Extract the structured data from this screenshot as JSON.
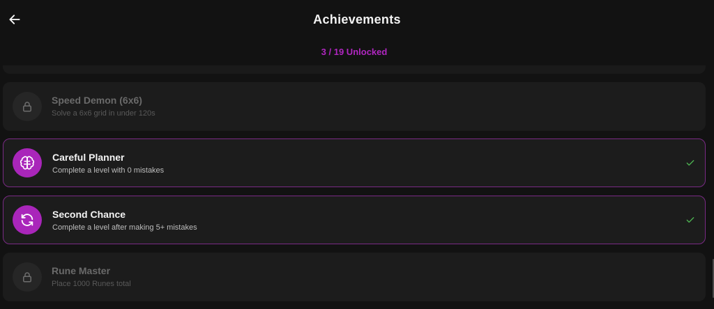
{
  "header": {
    "title": "Achievements",
    "progress_text": "3 / 19 Unlocked",
    "back_icon": "arrow-left-icon"
  },
  "colors": {
    "accent": "#a926ba",
    "check": "#4caf50",
    "background": "#121212"
  },
  "achievements": [
    {
      "name": "Speed Demon (6x6)",
      "description": "Solve a 6x6 grid in under 120s",
      "status": "locked",
      "icon": "lock-icon"
    },
    {
      "name": "Careful Planner",
      "description": "Complete a level with 0 mistakes",
      "status": "unlocked",
      "icon": "brain-icon"
    },
    {
      "name": "Second Chance",
      "description": "Complete a level after making 5+ mistakes",
      "status": "unlocked",
      "icon": "refresh-icon"
    },
    {
      "name": "Rune Master",
      "description": "Place 1000 Runes total",
      "status": "locked",
      "icon": "lock-icon"
    }
  ]
}
